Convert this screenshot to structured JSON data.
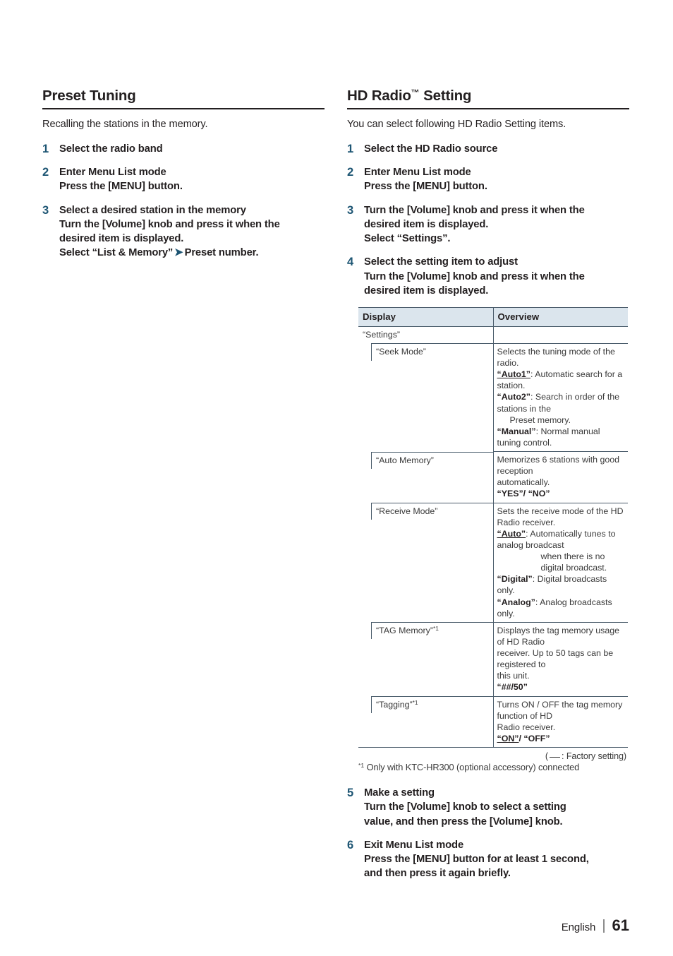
{
  "document": {
    "footer": {
      "language": "English",
      "page_number": "61",
      "separator": "|"
    }
  },
  "left_column": {
    "heading": "Preset Tuning",
    "intro": "Recalling the stations in the memory.",
    "steps": [
      {
        "number": "1",
        "title": "Select the radio band",
        "lines": []
      },
      {
        "number": "2",
        "title": "Enter Menu List mode",
        "lines": [
          "Press the [MENU] button."
        ]
      },
      {
        "number": "3",
        "title": "Select a desired station in the memory",
        "lines": [
          "Turn the [Volume] knob and press it when the",
          "desired item is displayed."
        ],
        "select_line": {
          "prefix": "Select “List & Memory”",
          "chevron": "➤",
          "suffix": "Preset number."
        }
      }
    ]
  },
  "right_column": {
    "heading": "HD Radio",
    "heading_tm": "™",
    "heading_suffix": " Setting",
    "intro": "You can select following HD Radio Setting items.",
    "steps_before_table": [
      {
        "number": "1",
        "title": "Select the HD Radio source",
        "lines": []
      },
      {
        "number": "2",
        "title": "Enter Menu List mode",
        "lines": [
          "Press the [MENU] button."
        ]
      },
      {
        "number": "3",
        "title": "Turn the [Volume] knob and press it when the",
        "lines": [
          "desired item is displayed.",
          "Select “Settings”."
        ]
      },
      {
        "number": "4",
        "title": "Select the setting item to adjust",
        "lines": [
          "Turn the [Volume] knob and press it when the",
          "desired item is displayed."
        ]
      }
    ],
    "table": {
      "columns": [
        "Display",
        "Overview"
      ],
      "parent_row": {
        "display": "“Settings”",
        "overview": ""
      },
      "rows": [
        {
          "display": "“Seek Mode”",
          "footnote_marker": "",
          "overview_lines": [
            {
              "type": "plain",
              "text": "Selects the tuning mode of the radio."
            },
            {
              "type": "value",
              "value": "“Auto1”",
              "factory": true,
              "text": ": Automatic search for a station."
            },
            {
              "type": "value",
              "value": "“Auto2”",
              "factory": false,
              "text": ": Search in order of the stations in the"
            },
            {
              "type": "indent",
              "text": "Preset memory."
            },
            {
              "type": "value",
              "value": "“Manual”",
              "factory": false,
              "text": ": Normal manual tuning control."
            }
          ]
        },
        {
          "display": "“Auto Memory”",
          "footnote_marker": "",
          "overview_lines": [
            {
              "type": "plain",
              "text": "Memorizes 6 stations with good reception"
            },
            {
              "type": "plain",
              "text": "automatically."
            },
            {
              "type": "value",
              "value": "“YES”/ “NO”",
              "factory": false,
              "text": ""
            }
          ]
        },
        {
          "display": "“Receive Mode”",
          "footnote_marker": "",
          "overview_lines": [
            {
              "type": "plain",
              "text": "Sets the receive mode of the HD Radio receiver."
            },
            {
              "type": "value",
              "value": "“Auto”",
              "factory": true,
              "text": ": Automatically tunes to analog broadcast"
            },
            {
              "type": "indent_far",
              "text": "when there is no digital broadcast."
            },
            {
              "type": "value",
              "value": "“Digital”",
              "factory": false,
              "text": ": Digital broadcasts only."
            },
            {
              "type": "value",
              "value": "“Analog”",
              "factory": false,
              "text": ": Analog broadcasts only."
            }
          ]
        },
        {
          "display": "“TAG Memory”",
          "footnote_marker": "*1",
          "overview_lines": [
            {
              "type": "plain",
              "text": "Displays the tag memory usage of HD Radio"
            },
            {
              "type": "plain",
              "text": "receiver. Up to 50 tags can be registered to"
            },
            {
              "type": "plain",
              "text": "this unit."
            },
            {
              "type": "value",
              "value": "“##/50”",
              "factory": false,
              "text": ""
            }
          ]
        },
        {
          "display": "“Tagging”",
          "footnote_marker": "*1",
          "overview_lines": [
            {
              "type": "plain",
              "text": "Turns ON / OFF the tag memory function of HD"
            },
            {
              "type": "plain",
              "text": "Radio receiver."
            },
            {
              "type": "value",
              "value": "“ON”",
              "factory": true,
              "text": ""
            },
            {
              "type": "value_inline",
              "value": "/ “OFF”",
              "factory": false,
              "text": ""
            }
          ]
        }
      ],
      "factory_note_open": "(",
      "factory_note_text": ": Factory setting)",
      "footnote": "Only with KTC-HR300 (optional accessory) connected",
      "footnote_marker": "*1"
    },
    "steps_after_table": [
      {
        "number": "5",
        "title": "Make a setting",
        "lines": [
          "Turn the [Volume] knob to select a setting",
          "value, and then press the [Volume] knob."
        ]
      },
      {
        "number": "6",
        "title": "Exit Menu List mode",
        "lines": [
          "Press the [MENU] button for at least 1 second,",
          "and then press it again briefly."
        ]
      }
    ]
  }
}
